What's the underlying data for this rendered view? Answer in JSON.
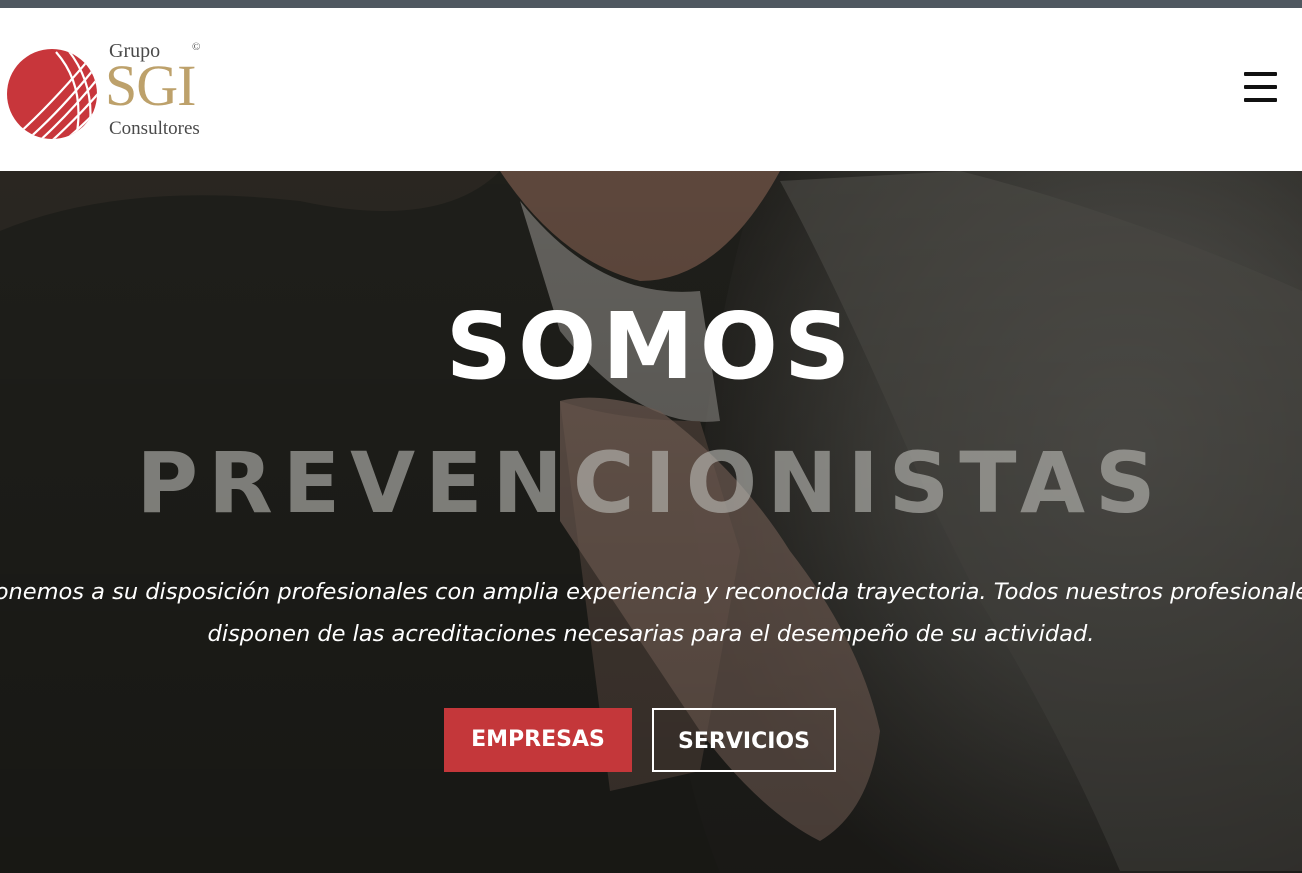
{
  "header": {
    "logo": {
      "grupo": "Grupo",
      "copyright": "©",
      "brand": "SGI",
      "consultores": "Consultores"
    },
    "menu_icon": "hamburger-menu-icon"
  },
  "hero": {
    "title": "SOMOS",
    "subtitle": "PREVENCIONISTAS",
    "text_line1": "Ponemos a su disposición profesionales con amplia experiencia y reconocida trayectoria. Todos nuestros profesionales",
    "text_line2": "disponen de las acreditaciones necesarias para el desempeño de su actividad.",
    "buttons": {
      "empresas": "EMPRESAS",
      "servicios": "SERVICIOS"
    }
  },
  "colors": {
    "brand_red": "#c4373a",
    "brand_gold": "#bda16b",
    "top_strip": "#4f5860"
  }
}
